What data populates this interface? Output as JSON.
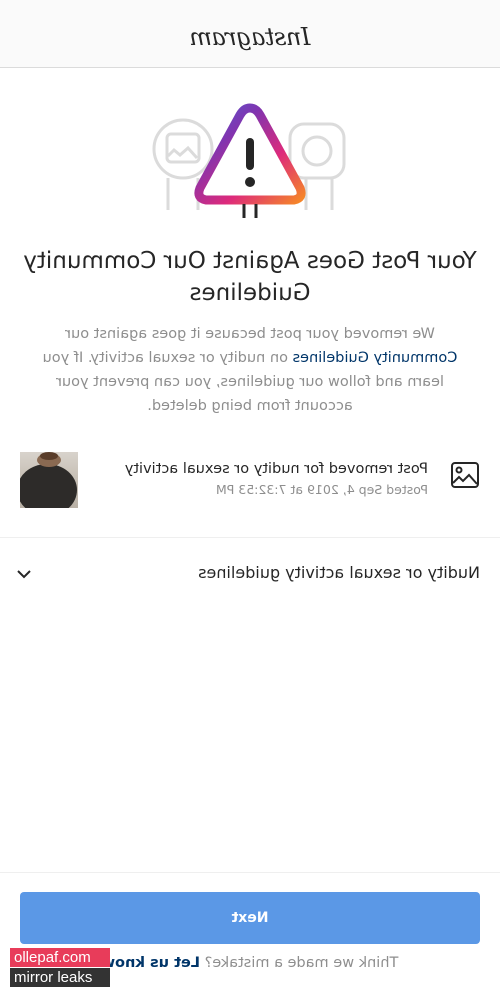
{
  "header": {
    "logo_text": "Instagram"
  },
  "hero": {
    "icons": [
      "photo-icon",
      "warning-triangle-icon",
      "chat-bubble-icon"
    ],
    "gradient": [
      "#f58529",
      "#dd2a7b",
      "#8134af",
      "#515bd4"
    ]
  },
  "title": "Your Post Goes Against Our Community Guidelines",
  "body": {
    "before_link": "We removed your post because it goes against our",
    "link": "Community Guidelines",
    "after_link": "on nudity or sexual activity. If you learn and follow our guidelines, you can prevent your account from being deleted."
  },
  "post": {
    "title": "Post removed for nudity or sexual activity",
    "date": "Posted Sep 4, 2019 at 7:32:53 PM"
  },
  "accordion": {
    "label": "Nudity or sexual activity guidelines"
  },
  "footer": {
    "next_label": "Next",
    "mistake_text": "Think we made a mistake?",
    "let_us_know": "Let us know"
  },
  "watermark": {
    "line1": "ollepaf.com",
    "line2": "mirror leaks"
  },
  "colors": {
    "button": "#5b98e6",
    "link": "#003569",
    "watermark_top": "#e83c5a",
    "watermark_bottom": "#333333"
  }
}
